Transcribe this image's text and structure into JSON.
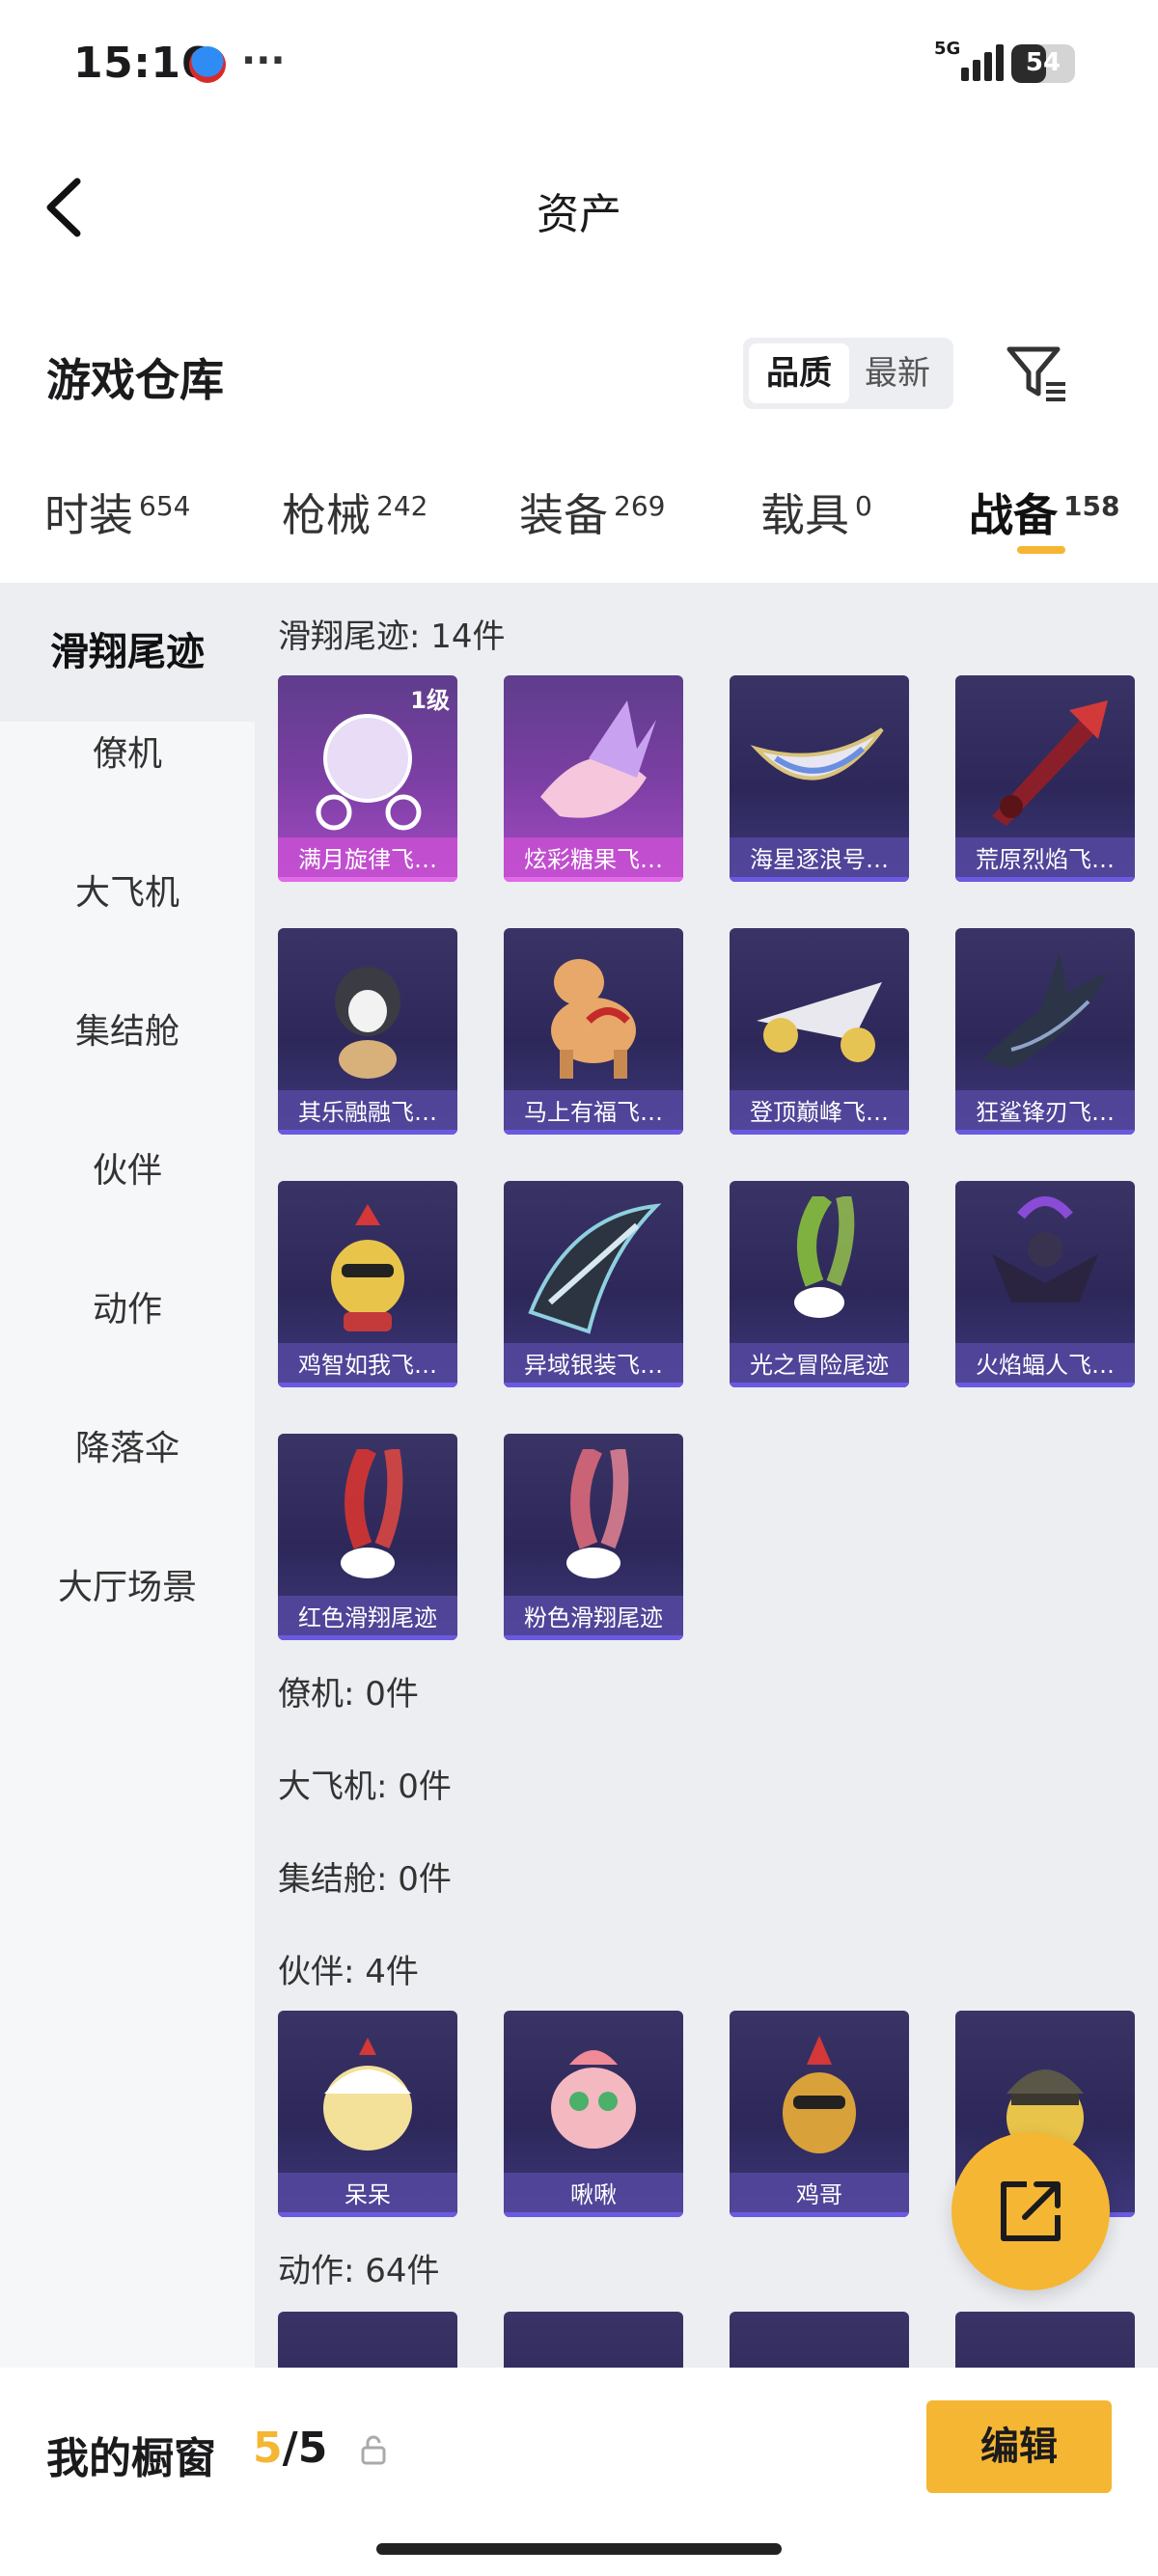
{
  "status_bar": {
    "time": "15:16",
    "dots": "···",
    "network": "5G",
    "battery": "54",
    "battery_level": 0.54
  },
  "header": {
    "title": "资产",
    "back_icon": "chevron-left-icon"
  },
  "section": {
    "title": "游戏仓库",
    "sort_options": [
      "品质",
      "最新"
    ],
    "active_sort": "品质",
    "filter_icon": "filter-icon"
  },
  "tabs": [
    {
      "label": "时装",
      "count": "654"
    },
    {
      "label": "枪械",
      "count": "242"
    },
    {
      "label": "装备",
      "count": "269"
    },
    {
      "label": "载具",
      "count": "0"
    },
    {
      "label": "战备",
      "count": "158",
      "active": true
    }
  ],
  "sidebar": {
    "items": [
      "滑翔尾迹",
      "僚机",
      "大飞机",
      "集结舱",
      "伙伴",
      "动作",
      "降落伞",
      "大厅场景"
    ],
    "active": "滑翔尾迹"
  },
  "content": {
    "groups": [
      {
        "title": "滑翔尾迹: 14件",
        "items": [
          {
            "name": "满月旋律飞…",
            "level": "1级",
            "rare": true,
            "icon": "carriage-icon"
          },
          {
            "name": "炫彩糖果飞…",
            "rare": true,
            "icon": "candy-icon"
          },
          {
            "name": "海星逐浪号…",
            "icon": "boat-icon"
          },
          {
            "name": "荒原烈焰飞…",
            "icon": "rocket-icon"
          },
          {
            "name": "其乐融融飞…",
            "icon": "penguin-icon"
          },
          {
            "name": "马上有福飞…",
            "icon": "horse-icon"
          },
          {
            "name": "登顶巅峰飞…",
            "icon": "jet-icon"
          },
          {
            "name": "狂鲨锋刃飞…",
            "icon": "shark-icon"
          },
          {
            "name": "鸡智如我飞…",
            "icon": "chicken-icon"
          },
          {
            "name": "异域银装飞…",
            "icon": "wing-icon"
          },
          {
            "name": "光之冒险尾迹",
            "icon": "green-smoke-icon"
          },
          {
            "name": "火焰蝠人飞…",
            "icon": "batman-icon"
          },
          {
            "name": "红色滑翔尾迹",
            "icon": "red-smoke-icon"
          },
          {
            "name": "粉色滑翔尾迹",
            "icon": "pink-smoke-icon"
          }
        ]
      },
      {
        "title": "僚机: 0件",
        "items": []
      },
      {
        "title": "大飞机: 0件",
        "items": []
      },
      {
        "title": "集结舱: 0件",
        "items": []
      },
      {
        "title": "伙伴: 4件",
        "items": [
          {
            "name": "呆呆",
            "icon": "chick-icon"
          },
          {
            "name": "啾啾",
            "icon": "pink-bird-icon"
          },
          {
            "name": "鸡哥",
            "icon": "rooster-icon"
          },
          {
            "name": "",
            "icon": "helmet-chick-icon"
          }
        ]
      },
      {
        "title": "动作: 64件",
        "items": []
      }
    ]
  },
  "bottom": {
    "label": "我的橱窗",
    "count_current": "5",
    "count_sep": "/",
    "count_total": "5",
    "edit_label": "编辑"
  },
  "fab": {
    "icon": "share-out-icon"
  },
  "colors": {
    "accent": "#f5b633",
    "card_normal": "#2d2859",
    "card_rare": "#a54bc4"
  }
}
